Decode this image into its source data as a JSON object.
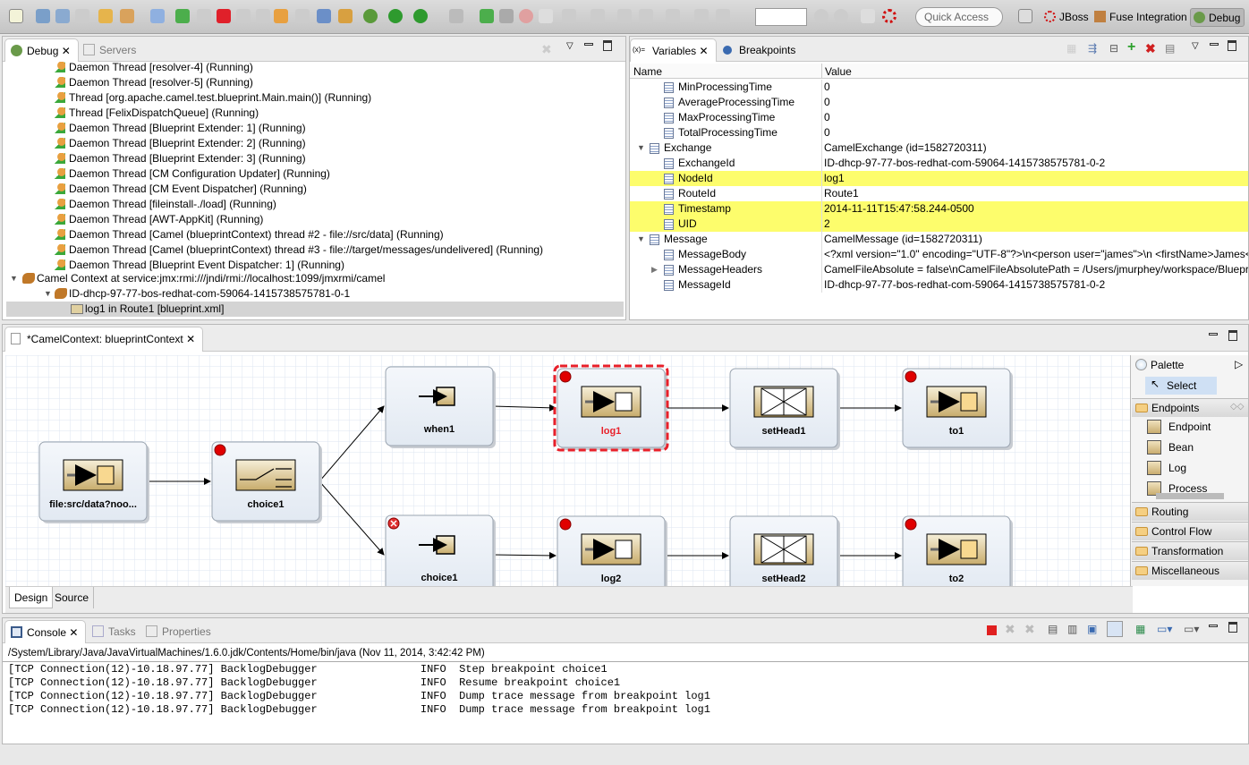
{
  "toolbar": {
    "quick_access": "Quick Access",
    "perspectives": [
      "JBoss",
      "Fuse Integration",
      "Debug"
    ],
    "zoom_value": ""
  },
  "debug": {
    "tabs": [
      "Debug",
      "Servers"
    ],
    "threads": [
      "Daemon Thread [resolver-4] (Running)",
      "Daemon Thread [resolver-5] (Running)",
      "Thread [org.apache.camel.test.blueprint.Main.main()] (Running)",
      "Thread [FelixDispatchQueue] (Running)",
      "Daemon Thread [Blueprint Extender: 1] (Running)",
      "Daemon Thread [Blueprint Extender: 2] (Running)",
      "Daemon Thread [Blueprint Extender: 3] (Running)",
      "Daemon Thread [CM Configuration Updater] (Running)",
      "Daemon Thread [CM Event Dispatcher] (Running)",
      "Daemon Thread [fileinstall-./load] (Running)",
      "Daemon Thread [AWT-AppKit] (Running)",
      "Daemon Thread [Camel (blueprintContext) thread #2 - file://src/data] (Running)",
      "Daemon Thread [Camel (blueprintContext) thread #3 - file://target/messages/undelivered] (Running)",
      "Daemon Thread [Blueprint Event Dispatcher: 1] (Running)"
    ],
    "camel_context": "Camel Context at service:jmx:rmi:///jndi/rmi://localhost:1099/jmxrmi/camel",
    "context_id": "ID-dhcp-97-77-bos-redhat-com-59064-1415738575781-0-1",
    "selected_frame": "log1 in Route1 [blueprint.xml]"
  },
  "variables": {
    "tabs": [
      "Variables",
      "Breakpoints"
    ],
    "columns": [
      "Name",
      "Value"
    ],
    "rows": [
      {
        "name": "MinProcessingTime",
        "value": "0",
        "level": 2
      },
      {
        "name": "AverageProcessingTime",
        "value": "0",
        "level": 2
      },
      {
        "name": "MaxProcessingTime",
        "value": "0",
        "level": 2
      },
      {
        "name": "TotalProcessingTime",
        "value": "0",
        "level": 2
      },
      {
        "name": "Exchange",
        "value": "CamelExchange (id=1582720311)",
        "level": 1,
        "expanded": true
      },
      {
        "name": "ExchangeId",
        "value": "ID-dhcp-97-77-bos-redhat-com-59064-1415738575781-0-2",
        "level": 2
      },
      {
        "name": "NodeId",
        "value": "log1",
        "level": 2,
        "highlight": true
      },
      {
        "name": "RouteId",
        "value": "Route1",
        "level": 2
      },
      {
        "name": "Timestamp",
        "value": "2014-11-11T15:47:58.244-0500",
        "level": 2,
        "highlight": true
      },
      {
        "name": "UID",
        "value": "2",
        "level": 2,
        "highlight": true
      },
      {
        "name": "Message",
        "value": "CamelMessage (id=1582720311)",
        "level": 1,
        "expanded": true
      },
      {
        "name": "MessageBody",
        "value": "<?xml version=\"1.0\" encoding=\"UTF-8\"?>\\n<person user=\"james\">\\n  <firstName>James</firstName>",
        "level": 2
      },
      {
        "name": "MessageHeaders",
        "value": "CamelFileAbsolute = false\\nCamelFileAbsolutePath = /Users/jmurphey/workspace/Blueprint",
        "level": 2,
        "collapsed": true
      },
      {
        "name": "MessageId",
        "value": "ID-dhcp-97-77-bos-redhat-com-59064-1415738575781-0-2",
        "level": 2
      }
    ],
    "highlight_color": "#fdfd6c"
  },
  "editor": {
    "tab": "*CamelContext: blueprintContext",
    "bottom_tabs": [
      "Design",
      "Source"
    ],
    "nodes": [
      {
        "id": "file",
        "label": "file:src/data?noo...",
        "icon": "endpoint",
        "bp": "none"
      },
      {
        "id": "choice1",
        "label": "choice1",
        "icon": "choice",
        "bp": "enabled"
      },
      {
        "id": "when1",
        "label": "when1",
        "icon": "when",
        "bp": "none"
      },
      {
        "id": "log1",
        "label": "log1",
        "icon": "log",
        "bp": "enabled",
        "selected": true
      },
      {
        "id": "setHead1",
        "label": "setHead1",
        "icon": "setheader",
        "bp": "none"
      },
      {
        "id": "to1",
        "label": "to1",
        "icon": "endpoint",
        "bp": "enabled"
      },
      {
        "id": "choice1b",
        "label": "choice1",
        "icon": "when",
        "bp": "error"
      },
      {
        "id": "log2",
        "label": "log2",
        "icon": "log",
        "bp": "enabled"
      },
      {
        "id": "setHead2",
        "label": "setHead2",
        "icon": "setheader",
        "bp": "none"
      },
      {
        "id": "to2",
        "label": "to2",
        "icon": "endpoint",
        "bp": "enabled"
      }
    ],
    "edges": [
      [
        "file",
        "choice1"
      ],
      [
        "choice1",
        "when1"
      ],
      [
        "choice1",
        "choice1b"
      ],
      [
        "when1",
        "log1"
      ],
      [
        "log1",
        "setHead1"
      ],
      [
        "setHead1",
        "to1"
      ],
      [
        "choice1b",
        "log2"
      ],
      [
        "log2",
        "setHead2"
      ],
      [
        "setHead2",
        "to2"
      ]
    ],
    "selected_color": "#e8202a"
  },
  "palette": {
    "title": "Palette",
    "select": "Select",
    "drawers": [
      "Endpoints",
      "Routing",
      "Control Flow",
      "Transformation",
      "Miscellaneous"
    ],
    "endpoint_items": [
      "Endpoint",
      "Bean",
      "Log",
      "Process"
    ]
  },
  "console": {
    "tabs": [
      "Console",
      "Tasks",
      "Properties"
    ],
    "header": "/System/Library/Java/JavaVirtualMachines/1.6.0.jdk/Contents/Home/bin/java (Nov 11, 2014, 3:42:42 PM)",
    "lines": [
      "[TCP Connection(12)-10.18.97.77] BacklogDebugger                INFO  Step breakpoint choice1",
      "[TCP Connection(12)-10.18.97.77] BacklogDebugger                INFO  Resume breakpoint choice1",
      "[TCP Connection(12)-10.18.97.77] BacklogDebugger                INFO  Dump trace message from breakpoint log1",
      "[TCP Connection(12)-10.18.97.77] BacklogDebugger                INFO  Dump trace message from breakpoint log1"
    ]
  }
}
